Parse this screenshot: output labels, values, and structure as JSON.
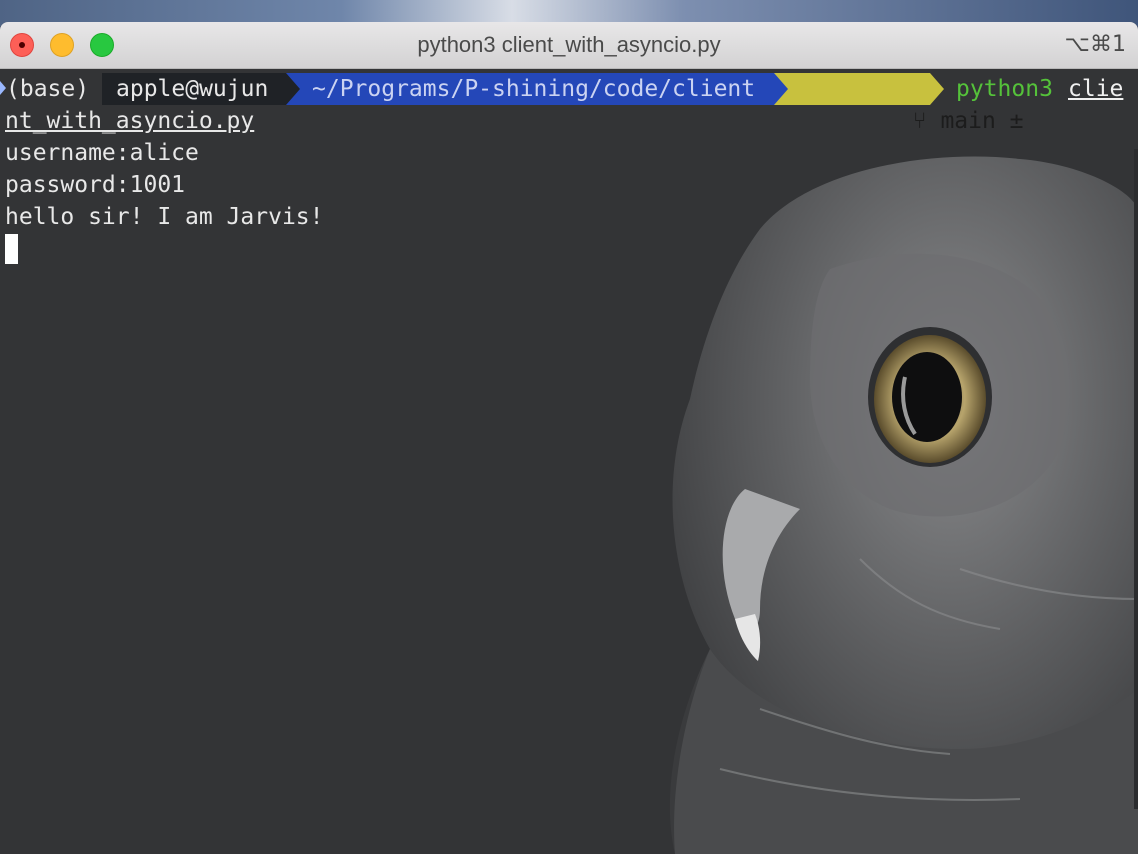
{
  "window": {
    "title": "python3 client_with_asyncio.py",
    "shortcut": "⌥⌘1"
  },
  "prompt": {
    "env": "(base)",
    "user": "apple@wujun",
    "path": "~/Programs/P-shining/code/client",
    "git_icon": "branch-icon",
    "branch": "main ±",
    "command": "python3",
    "argument_start": "clie",
    "argument_end": "nt_with_asyncio.py"
  },
  "output": {
    "line1": "username:alice",
    "line2": "password:1001",
    "line3": "hello sir! I am Jarvis!"
  },
  "colors": {
    "terminal_bg": "#333436",
    "path_segment": "#2447b8",
    "git_segment": "#c8c13e",
    "command": "#55c23a"
  }
}
